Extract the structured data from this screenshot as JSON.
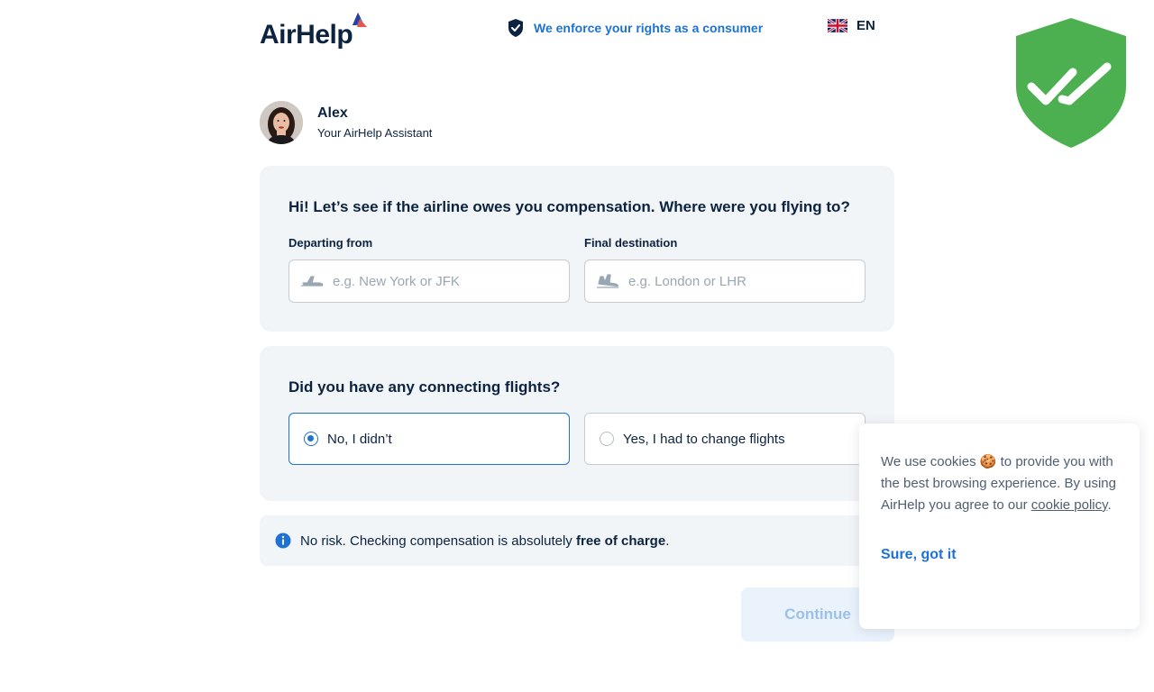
{
  "header": {
    "logo_text": "AirHelp",
    "tagline": "We enforce your rights as a consumer",
    "language": "EN"
  },
  "assistant": {
    "name": "Alex",
    "role": "Your AirHelp Assistant"
  },
  "route_card": {
    "title": "Hi! Let’s see if the airline owes you compensation. Where were you flying to?",
    "departing_label": "Departing from",
    "departing_placeholder": "e.g. New York or JFK",
    "departing_value": "",
    "destination_label": "Final destination",
    "destination_placeholder": "e.g. London or LHR",
    "destination_value": ""
  },
  "connecting_card": {
    "title": "Did you have any connecting flights?",
    "options": [
      {
        "label": "No, I didn’t",
        "selected": true
      },
      {
        "label": "Yes, I had to change flights",
        "selected": false
      }
    ]
  },
  "info": {
    "text_before": "No risk. Checking compensation is absolutely ",
    "text_bold": "free of charge",
    "text_after": "."
  },
  "continue_label": "Continue",
  "cookie": {
    "text_part1": "We use cookies",
    "emoji": "🍪",
    "text_part2": "to provide you with the best browsing experience. By using AirHelp you agree to our",
    "link": "cookie policy",
    "text_end": ".",
    "button": "Sure, got it"
  },
  "colors": {
    "brand_navy": "#0c2340",
    "brand_blue": "#1e72d3",
    "card_bg": "#f2f5f8",
    "badge_green": "#4caf50"
  },
  "icons": [
    "airhelp-logo-mark",
    "shield-check-icon",
    "uk-flag-icon",
    "plane-takeoff-icon",
    "plane-landing-icon",
    "info-icon",
    "security-badge-icon"
  ]
}
